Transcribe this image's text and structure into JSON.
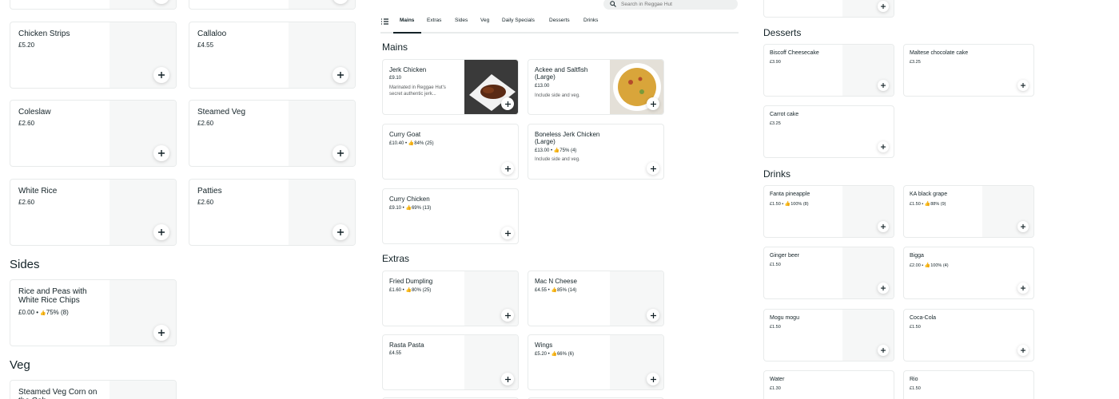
{
  "search": {
    "placeholder": "Search in Reggae Hut"
  },
  "tabs": [
    "Mains",
    "Extras",
    "Sides",
    "Veg",
    "Daily Specials",
    "Desserts",
    "Drinks"
  ],
  "left": {
    "items": [
      {
        "name": "Chicken Strips",
        "price": "£5.20"
      },
      {
        "name": "Callaloo",
        "price": "£4.55"
      },
      {
        "name": "Coleslaw",
        "price": "£2.60"
      },
      {
        "name": "Steamed Veg",
        "price": "£2.60"
      },
      {
        "name": "White Rice",
        "price": "£2.60"
      },
      {
        "name": "Patties",
        "price": "£2.60"
      }
    ],
    "sides_title": "Sides",
    "sides_item": {
      "name": "Rice and Peas with White Rice Chips",
      "price": "£0.00",
      "rating": "75% (8)"
    },
    "veg_title": "Veg",
    "veg_item": {
      "name": "Steamed Veg Corn on the Cob"
    }
  },
  "mains": {
    "title": "Mains",
    "items": [
      {
        "name": "Jerk Chicken",
        "price": "£9.10",
        "desc": "Marinated in Reggae Hut's secret authentic jerk..."
      },
      {
        "name": "Ackee and Saltfish (Large)",
        "price": "£13.00",
        "desc": "Include side and veg."
      },
      {
        "name": "Curry Goat",
        "price": "£10.40",
        "rating": "84% (25)"
      },
      {
        "name": "Boneless Jerk Chicken (Large)",
        "price": "£13.00",
        "rating": "75% (4)",
        "desc": "Include side and veg."
      },
      {
        "name": "Curry Chicken",
        "price": "£9.10",
        "rating": "69% (13)"
      }
    ]
  },
  "extras": {
    "title": "Extras",
    "items": [
      {
        "name": "Fried Dumpling",
        "price": "£1.60",
        "rating": "80% (25)"
      },
      {
        "name": "Mac N Cheese",
        "price": "£4.55",
        "rating": "85% (14)"
      },
      {
        "name": "Rasta Pasta",
        "price": "£4.55"
      },
      {
        "name": "Wings",
        "price": "£5.20",
        "rating": "66% (6)"
      }
    ]
  },
  "desserts": {
    "title": "Desserts",
    "items": [
      {
        "name": "Biscoff Cheesecake",
        "price": "£3.90"
      },
      {
        "name": "Maltese chocolate cake",
        "price": "£3.25"
      },
      {
        "name": "Carrot cake",
        "price": "£3.25"
      }
    ]
  },
  "drinks": {
    "title": "Drinks",
    "items": [
      {
        "name": "Fanta pineapple",
        "price": "£1.50",
        "rating": "100% (8)"
      },
      {
        "name": "KA black grape",
        "price": "£1.50",
        "rating": "88% (9)"
      },
      {
        "name": "Ginger beer",
        "price": "£1.50"
      },
      {
        "name": "Bigga",
        "price": "£2.00",
        "rating": "100% (4)"
      },
      {
        "name": "Mogu mogu",
        "price": "£1.50"
      },
      {
        "name": "Coca-Cola",
        "price": "£1.50"
      },
      {
        "name": "Water",
        "price": "£1.30"
      },
      {
        "name": "Rio",
        "price": "£1.50"
      }
    ]
  },
  "colors": {
    "text": "#142328",
    "muted": "#585c5e",
    "border": "#e8ebeb",
    "placeholder": "#f6f7f7"
  }
}
